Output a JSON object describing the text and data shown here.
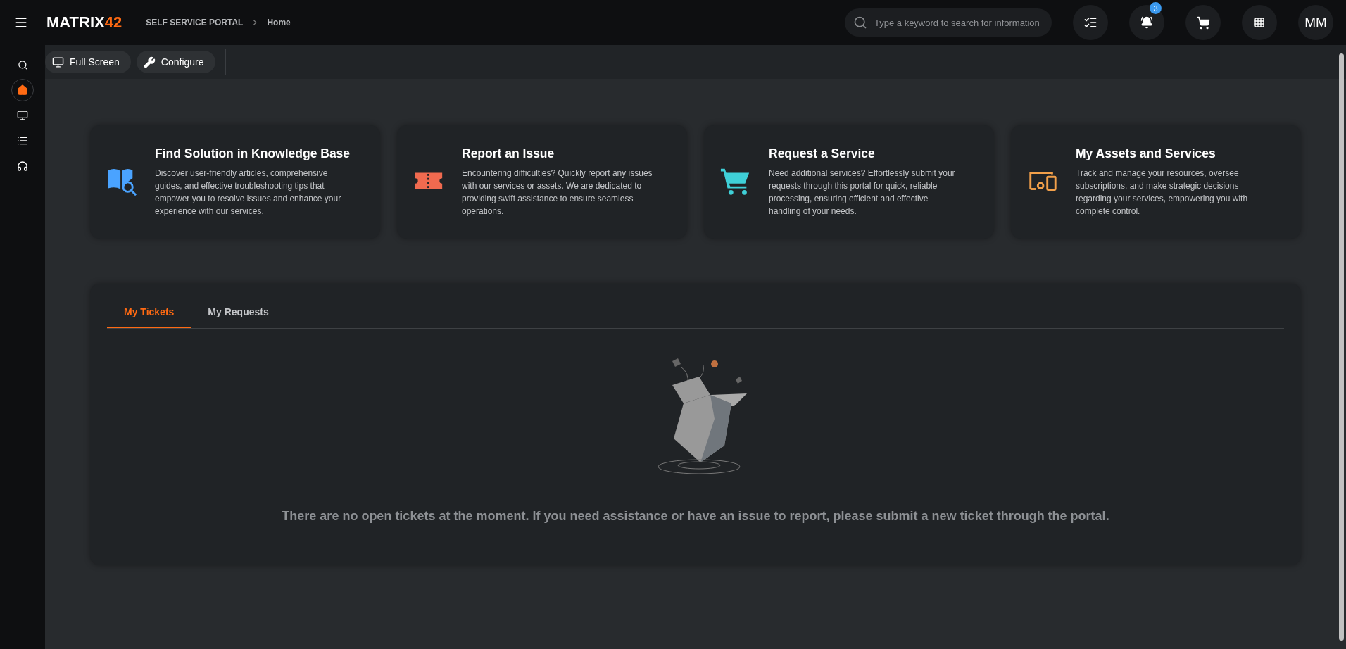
{
  "header": {
    "logo": {
      "text": "MATRIX",
      "accent": "42"
    },
    "breadcrumb": [
      {
        "label": "SELF SERVICE PORTAL"
      },
      {
        "label": "Home"
      }
    ],
    "search": {
      "placeholder": "Type a keyword to search for information"
    },
    "notifications": {
      "badge": "3"
    },
    "avatar": "MM"
  },
  "sidebar": {
    "items": [
      {
        "kind": "search",
        "selected": false
      },
      {
        "kind": "home",
        "selected": true
      },
      {
        "kind": "computer",
        "selected": false
      },
      {
        "kind": "list",
        "selected": false
      },
      {
        "kind": "headset",
        "selected": false
      }
    ]
  },
  "toolbar": {
    "buttons": [
      {
        "kind": "screen",
        "label": "Full Screen"
      },
      {
        "kind": "wrench",
        "label": "Configure"
      }
    ]
  },
  "cards": [
    {
      "kind": "book",
      "color": "#4aa3ff",
      "title": "Find Solution in Knowledge Base",
      "text": "Discover user-friendly articles, comprehensive guides, and effective troubleshooting tips that empower you to resolve issues and enhance your experience with our services."
    },
    {
      "kind": "ticket",
      "color": "#f06a4f",
      "title": "Report an Issue",
      "text": "Encountering difficulties? Quickly report any issues with our services or assets. We are dedicated to providing swift assistance to ensure seamless operations."
    },
    {
      "kind": "cart",
      "color": "#3fd0d8",
      "title": "Request a Service",
      "text": "Need additional services? Effortlessly submit your requests through this portal for quick, reliable processing, ensuring efficient and effective handling of your needs."
    },
    {
      "kind": "devices",
      "color": "#f2a04a",
      "title": "My Assets and Services",
      "text": "Track and manage your resources, oversee subscriptions, and make strategic decisions regarding your services, empowering you with complete control."
    }
  ],
  "tickets": {
    "tabs": [
      {
        "label": "My Tickets",
        "selected": true
      },
      {
        "label": "My Requests",
        "selected": false
      }
    ],
    "empty_message": "There are no open tickets at the moment. If you need assistance or have an issue to report, please submit a new ticket through the portal."
  }
}
